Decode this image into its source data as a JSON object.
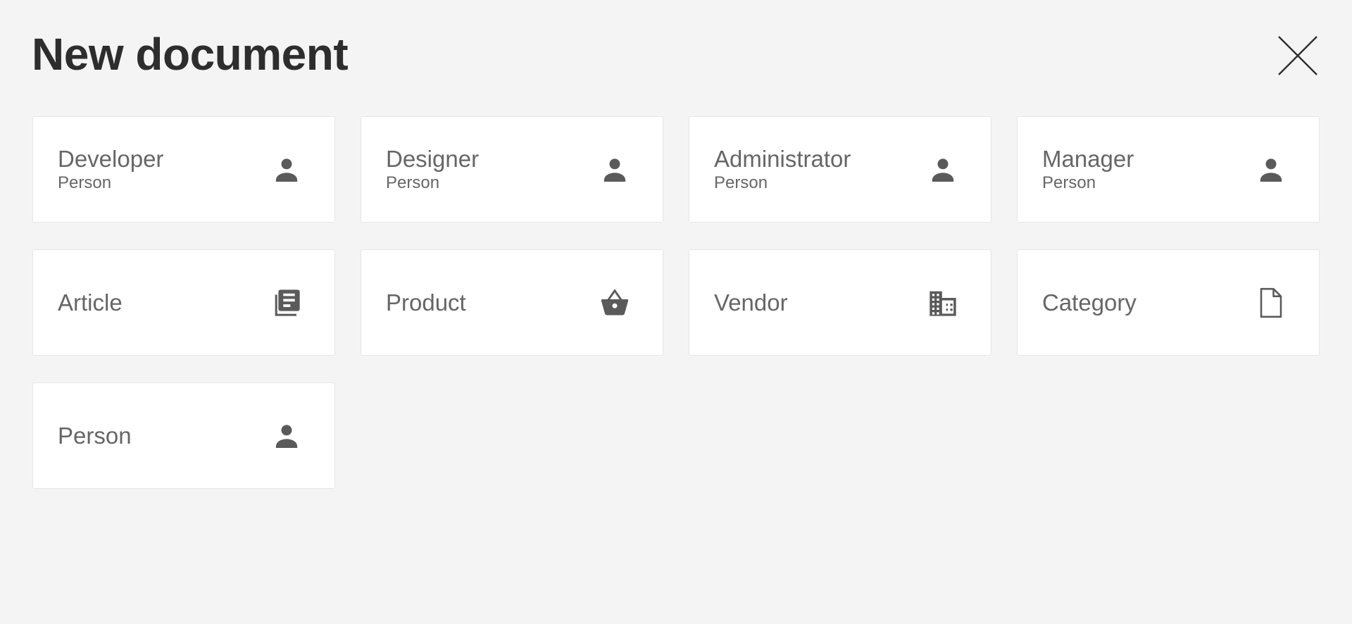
{
  "header": {
    "title": "New document",
    "close_icon": "close-icon"
  },
  "cards": [
    {
      "title": "Developer",
      "subtitle": "Person",
      "icon": "person-icon"
    },
    {
      "title": "Designer",
      "subtitle": "Person",
      "icon": "person-icon"
    },
    {
      "title": "Administrator",
      "subtitle": "Person",
      "icon": "person-icon"
    },
    {
      "title": "Manager",
      "subtitle": "Person",
      "icon": "person-icon"
    },
    {
      "title": "Article",
      "subtitle": "",
      "icon": "article-icon"
    },
    {
      "title": "Product",
      "subtitle": "",
      "icon": "basket-icon"
    },
    {
      "title": "Vendor",
      "subtitle": "",
      "icon": "building-icon"
    },
    {
      "title": "Category",
      "subtitle": "",
      "icon": "document-icon"
    },
    {
      "title": "Person",
      "subtitle": "",
      "icon": "person-icon"
    }
  ],
  "colors": {
    "background": "#f4f4f4",
    "card": "#ffffff",
    "text": "#666666",
    "title": "#2d2d2d",
    "icon": "#5a5a5a"
  }
}
